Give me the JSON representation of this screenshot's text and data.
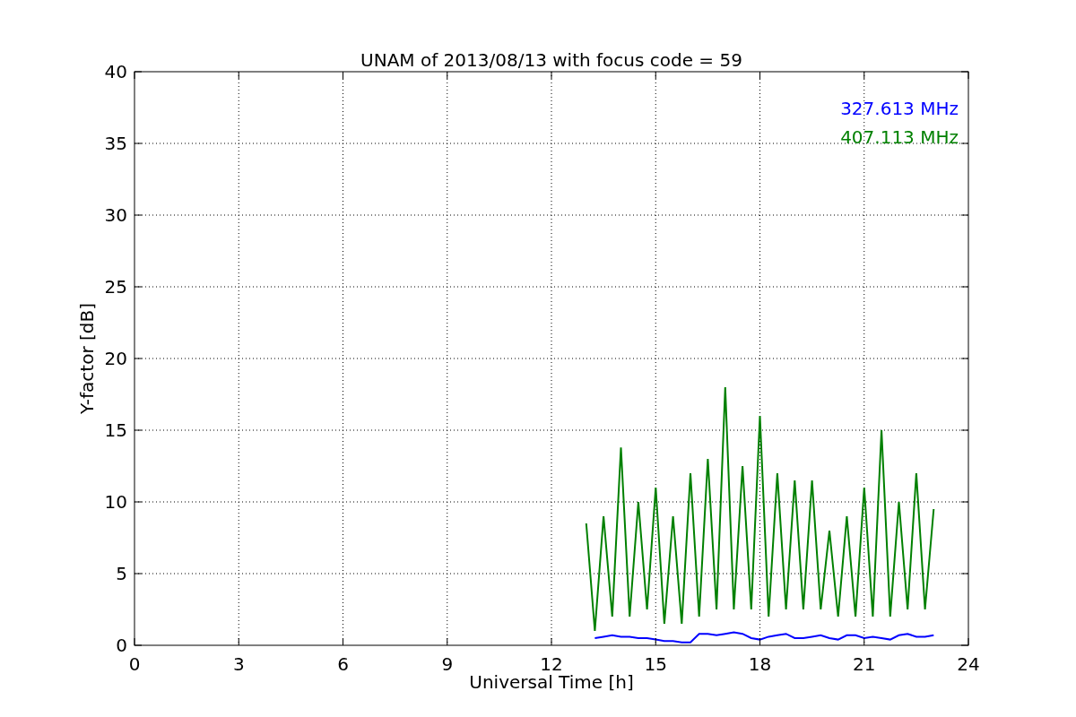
{
  "chart": {
    "chart_data": {
      "type": "line",
      "title": "UNAM of 2013/08/13 with focus code = 59",
      "xlabel": "Universal Time [h]",
      "ylabel": "Y-factor [dB]",
      "x": [
        13,
        13.25,
        13.5,
        13.75,
        14,
        14.25,
        14.5,
        14.75,
        15,
        15.25,
        15.5,
        15.75,
        16,
        16.25,
        16.5,
        16.75,
        17,
        17.25,
        17.5,
        17.75,
        18,
        18.25,
        18.5,
        18.75,
        19,
        19.25,
        19.5,
        19.75,
        20,
        20.25,
        20.5,
        20.75,
        21,
        21.25,
        21.5,
        21.75,
        22,
        22.25,
        22.5,
        22.75,
        23
      ],
      "series": [
        {
          "name": "327.613 MHz",
          "color": "#0000ff",
          "values": [
            null,
            0.5,
            0.6,
            0.7,
            0.6,
            0.6,
            0.5,
            0.5,
            0.4,
            0.3,
            0.3,
            0.2,
            0.2,
            0.8,
            0.8,
            0.7,
            0.8,
            0.9,
            0.8,
            0.5,
            0.4,
            0.6,
            0.7,
            0.8,
            0.5,
            0.5,
            0.6,
            0.7,
            0.5,
            0.4,
            0.7,
            0.7,
            0.5,
            0.6,
            0.5,
            0.4,
            0.7,
            0.8,
            0.6,
            0.6,
            0.7
          ]
        },
        {
          "name": "407.113 MHz",
          "color": "#008000",
          "values": [
            8.5,
            1,
            9,
            2,
            13.8,
            2,
            10,
            2.5,
            11,
            1.5,
            9,
            1.5,
            12,
            2,
            13,
            2.5,
            18,
            2.5,
            12.5,
            2.5,
            16,
            2,
            12,
            2.5,
            11.5,
            2.5,
            11.5,
            2.5,
            8,
            2,
            9,
            2,
            11,
            2,
            15,
            2,
            10,
            2.5,
            12,
            2.5,
            9.5
          ]
        }
      ],
      "grid": true,
      "xlim": [
        0,
        24
      ],
      "ylim": [
        0,
        40
      ],
      "xticks": [
        0,
        3,
        6,
        9,
        12,
        15,
        18,
        21,
        24
      ],
      "yticks": [
        0,
        5,
        10,
        15,
        20,
        25,
        30,
        35,
        40
      ]
    }
  }
}
